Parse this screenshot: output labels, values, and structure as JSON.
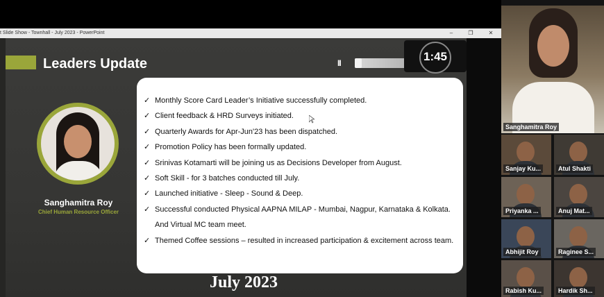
{
  "window": {
    "title": "t Slide Show - Townhall - July 2023 - PowerPoint",
    "minimize": "–",
    "restore": "❐",
    "close": "✕"
  },
  "slide": {
    "title": "Leaders Update",
    "accent_color": "#9aa63a",
    "person_name": "Sanghamitra Roy",
    "person_role": "Chief Human Resource Officer",
    "bullets": [
      "Monthly Score Card Leader’s Initiative successfully completed.",
      "Client feedback & HRD Surveys initiated.",
      "Quarterly Awards for Apr-Jun'23 has been dispatched.",
      "Promotion Policy has been formally updated.",
      "Srinivas Kotamarti will be joining us as Decisions Developer from August.",
      "Soft Skill - for 3 batches conducted till July.",
      "Launched initiative - Sleep - Sound & Deep.",
      "Successful conducted Physical AAPNA MILAP - Mumbai, Nagpur, Karnataka & Kolkata. And Virtual MC team meet.",
      "Themed Coffee sessions – resulted in increased participation & excitement across team."
    ],
    "check_glyph": "✓"
  },
  "media_player": {
    "pause_glyph": "II",
    "volume_icon": "speaker-icon",
    "timer": "1:45"
  },
  "caption": "July 2023",
  "participants": [
    {
      "name": "Sanghamitra Roy"
    },
    {
      "name": "Sanjay Ku..."
    },
    {
      "name": "Atul Shakti"
    },
    {
      "name": "Priyanka ..."
    },
    {
      "name": "Anuj Mat..."
    },
    {
      "name": "Abhijit Roy"
    },
    {
      "name": "Raginee S..."
    },
    {
      "name": "Rabish Ku..."
    },
    {
      "name": "Hardik Sh..."
    }
  ]
}
